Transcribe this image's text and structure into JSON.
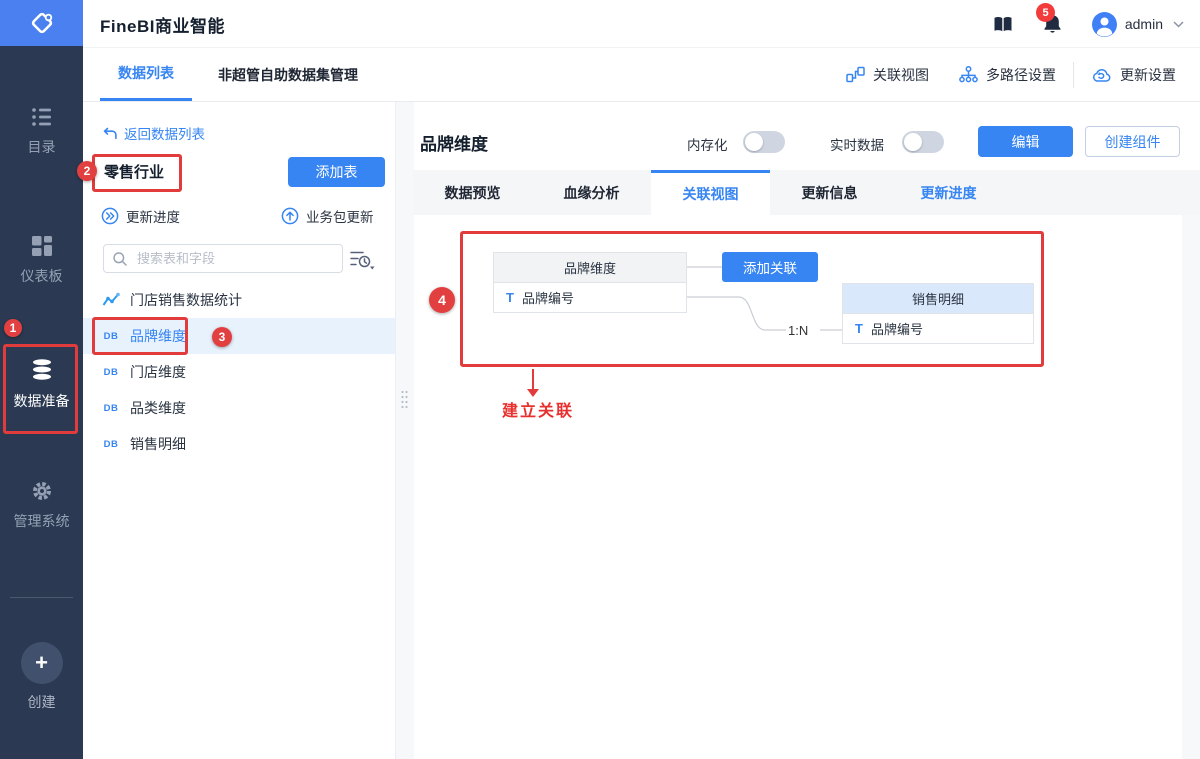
{
  "colors": {
    "accent": "#3685f2",
    "annotation_red": "#e23b3b",
    "sidebar_bg": "#2b3a52",
    "logo_bg": "#4a80f0",
    "selected_row_bg": "#e8f2fd",
    "right_card_header_bg": "#d9e8fb",
    "tabbar_bg": "#f5f6f8"
  },
  "app_header": {
    "title": "FineBI商业智能",
    "notification_count": "5",
    "user_name": "admin"
  },
  "sidebar": {
    "items": [
      {
        "label": "目录"
      },
      {
        "label": "仪表板"
      },
      {
        "label": "数据准备"
      },
      {
        "label": "管理系统"
      }
    ],
    "create_label": "创建"
  },
  "panel": {
    "tabs": [
      {
        "label": "数据列表"
      },
      {
        "label": "非超管自助数据集管理"
      }
    ],
    "back_label": "返回数据列表",
    "package_name": "零售行业",
    "add_table_label": "添加表",
    "update_progress_label": "更新进度",
    "package_update_label": "业务包更新",
    "search_placeholder": "搜索表和字段",
    "db_icon_text": "DB",
    "tables": [
      {
        "label": "门店销售数据统计",
        "type": "chart"
      },
      {
        "label": "品牌维度",
        "type": "db"
      },
      {
        "label": "门店维度",
        "type": "db"
      },
      {
        "label": "品类维度",
        "type": "db"
      },
      {
        "label": "销售明细",
        "type": "db"
      }
    ]
  },
  "toolbar": {
    "relation_view_label": "关联视图",
    "multipath_label": "多路径设置",
    "update_settings_label": "更新设置"
  },
  "main": {
    "title": "品牌维度",
    "memory_label": "内存化",
    "realtime_label": "实时数据",
    "edit_label": "编辑",
    "create_component_label": "创建组件",
    "tabs": [
      {
        "label": "数据预览"
      },
      {
        "label": "血缘分析"
      },
      {
        "label": "关联视图"
      },
      {
        "label": "更新信息"
      },
      {
        "label": "更新进度"
      }
    ]
  },
  "diagram": {
    "left_table": {
      "title": "品牌维度",
      "field_type": "T",
      "field_name": "品牌编号"
    },
    "add_relation_label": "添加关联",
    "right_table": {
      "title": "销售明细",
      "field_type": "T",
      "field_name": "品牌编号"
    },
    "cardinality": "1:N"
  },
  "annotations": {
    "steps": [
      "1",
      "2",
      "3",
      "4"
    ],
    "note_label": "建立关联"
  }
}
